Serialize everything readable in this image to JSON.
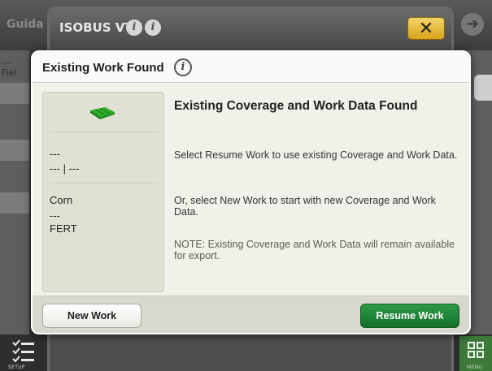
{
  "background": {
    "left_tab_label": "Guida",
    "left_panel_text": "---\nFiel",
    "setup_label": "SETUP",
    "menu_label": "MENU"
  },
  "vt": {
    "title": "ISOBUS VT",
    "close_symbol": "✕"
  },
  "dialog": {
    "title": "Existing Work Found",
    "summary": {
      "line1": "---",
      "line2": "--- | ---",
      "crop": "Corn",
      "line4": "---",
      "product": "FERT"
    },
    "message": {
      "heading": "Existing Coverage and Work Data Found",
      "p1": "Select Resume Work to use existing Coverage and Work Data.",
      "p2": "Or, select New Work to start with new Coverage and Work Data.",
      "note": "NOTE: Existing Coverage and Work Data will remain available for export."
    },
    "buttons": {
      "new_work": "New Work",
      "resume_work": "Resume Work"
    }
  },
  "colors": {
    "accent_green": "#1e8a3a",
    "implement_green": "#2eae2a",
    "close_yellow": "#e7b42b"
  }
}
